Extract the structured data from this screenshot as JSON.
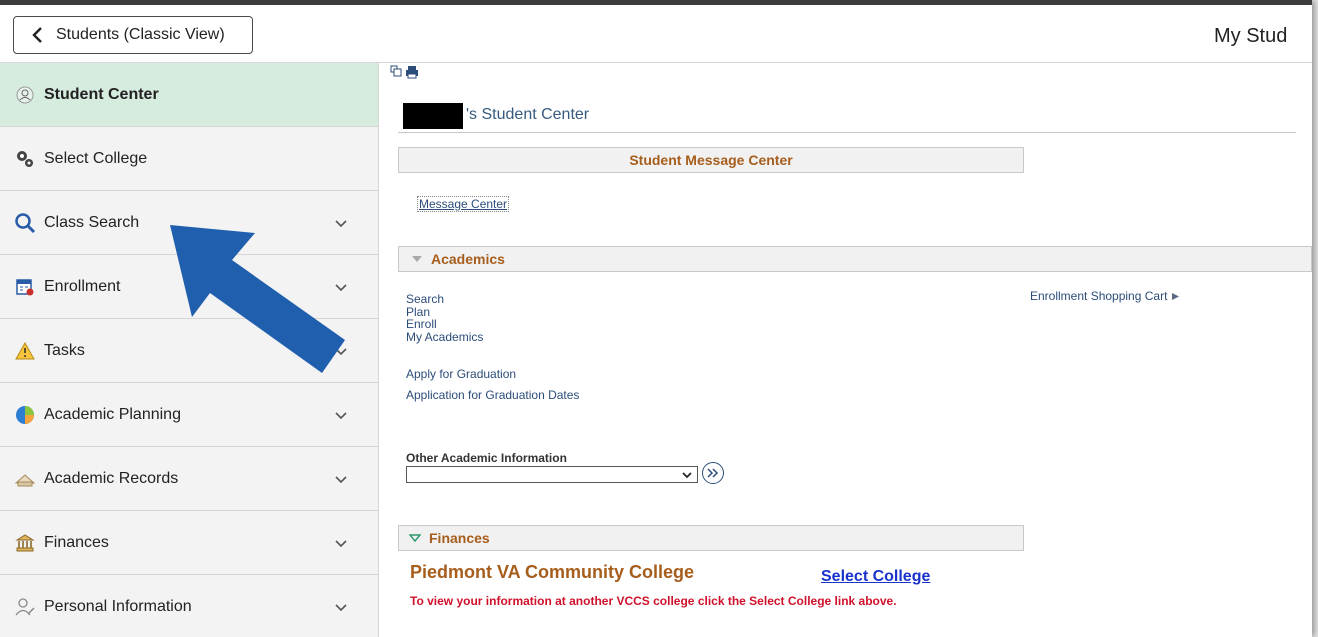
{
  "header": {
    "back_label": "Students (Classic View)",
    "page_title": "My Stud"
  },
  "sidebar": {
    "items": [
      {
        "label": "Student Center",
        "icon": "student-icon"
      },
      {
        "label": "Select College",
        "icon": "gears-icon"
      },
      {
        "label": "Class Search",
        "icon": "search-icon"
      },
      {
        "label": "Enrollment",
        "icon": "calendar-icon"
      },
      {
        "label": "Tasks",
        "icon": "warning-icon"
      },
      {
        "label": "Academic Planning",
        "icon": "pie-chart-icon"
      },
      {
        "label": "Academic Records",
        "icon": "records-icon"
      },
      {
        "label": "Finances",
        "icon": "bank-icon"
      },
      {
        "label": "Personal Information",
        "icon": "person-icon"
      }
    ]
  },
  "main": {
    "student_center_title": "'s Student Center",
    "message_center_header": "Student Message Center",
    "message_center_link": "Message Center",
    "academics_header": "Academics",
    "academic_links": [
      "Search",
      "Plan",
      "Enroll",
      "My Academics",
      "Apply for Graduation",
      "Application for Graduation Dates"
    ],
    "enrollment_shopping_cart": "Enrollment Shopping Cart",
    "other_academic_label": "Other Academic Information",
    "other_academic_selected": "",
    "finances_header": "Finances",
    "college_name": "Piedmont VA Community College",
    "select_college_link": "Select College",
    "college_note": "To view your information at another VCCS college click the Select College link above."
  },
  "colors": {
    "active_nav": "#d6ecdf",
    "section_title": "#a75d1c",
    "link": "#2c4d7a",
    "note_red": "#d0112b",
    "arrow_blue": "#1f5fad"
  }
}
